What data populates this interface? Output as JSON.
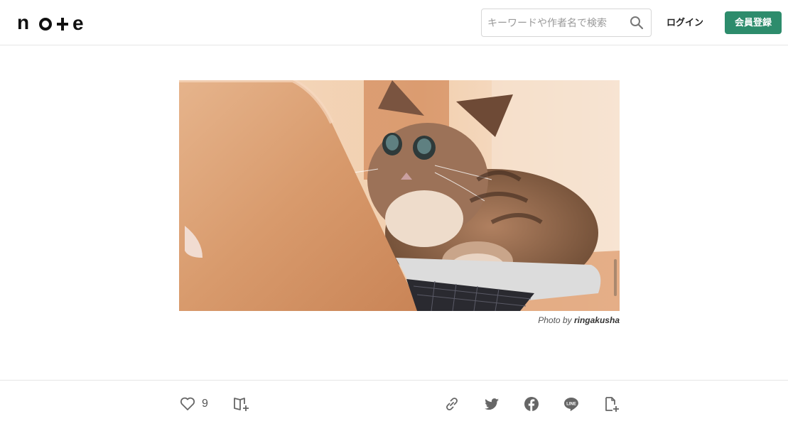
{
  "header": {
    "logo_text": "note",
    "search": {
      "placeholder": "キーワードや作者名で検索",
      "value": "",
      "icon": "search-icon"
    },
    "login_label": "ログイン",
    "signup_label": "会員登録"
  },
  "hero": {
    "credit_prefix": "Photo by",
    "credit_author": "ringakusha"
  },
  "actions": {
    "like_count": "9",
    "left_icons": [
      "heart-icon",
      "add-to-magazine-icon"
    ],
    "share_icons": [
      "link-icon",
      "twitter-icon",
      "facebook-icon",
      "line-icon",
      "embed-icon"
    ],
    "line_icon_text": "LINE"
  },
  "colors": {
    "accent": "#2d8c6c",
    "icon": "#666666",
    "border": "#e6e6e6"
  }
}
